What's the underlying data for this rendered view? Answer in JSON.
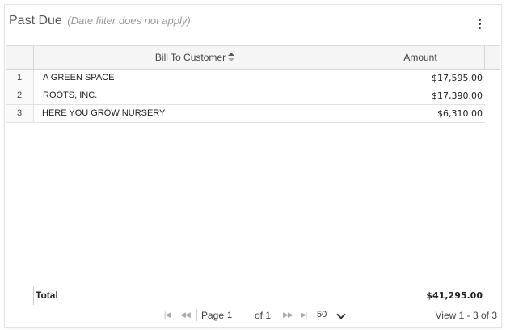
{
  "header": {
    "title": "Past Due",
    "subtitle": "(Date filter does not apply)"
  },
  "grid": {
    "columns": {
      "customer": "Bill To Customer",
      "amount": "Amount"
    },
    "rows": [
      {
        "num": "1",
        "customer": "A GREEN SPACE",
        "amount": "$17,595.00"
      },
      {
        "num": "2",
        "customer": "ROOTS, INC.",
        "amount": "$17,390.00"
      },
      {
        "num": "3",
        "customer": "HERE YOU GROW NURSERY",
        "amount": "$6,310.00"
      }
    ],
    "footer": {
      "label": "Total",
      "amount": "$41,295.00"
    }
  },
  "pager": {
    "page_label": "Page",
    "page_value": "1",
    "of_label": "of 1",
    "page_size": "50",
    "view_text": "View 1 - 3 of 3"
  }
}
